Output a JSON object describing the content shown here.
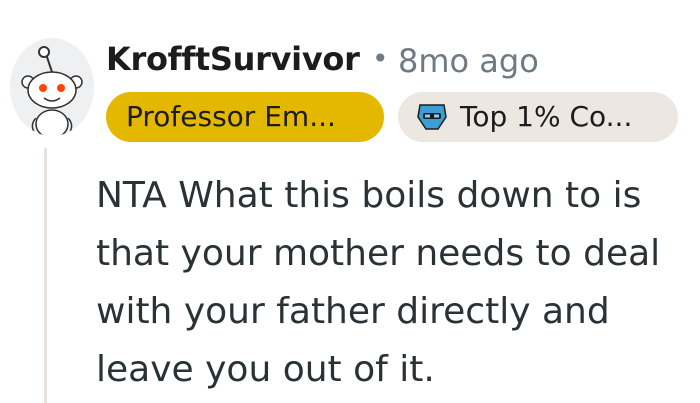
{
  "comment": {
    "username": "KrofftSurvivor",
    "separator": "•",
    "timestamp": "8mo ago",
    "flairs": [
      {
        "label": "Professor Em..."
      },
      {
        "label": "Top 1% Co...",
        "icon": "top-contributor-badge-icon"
      }
    ],
    "body": "NTA What this boils down to is that your mother needs to deal with your father directly and leave you out of it."
  },
  "colors": {
    "flair_primary": "#e5b800",
    "flair_secondary": "#ece7e1",
    "meta_text": "#6f7a83",
    "thread_line": "#e6e3df"
  }
}
